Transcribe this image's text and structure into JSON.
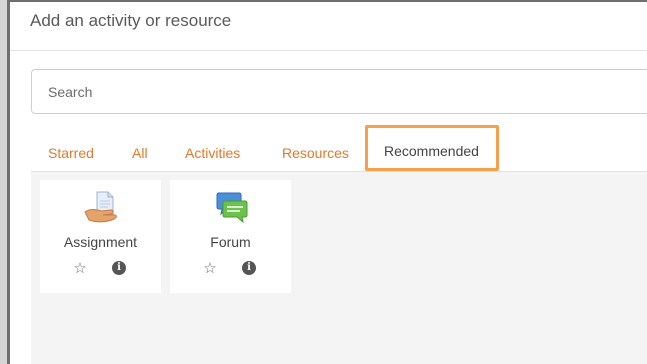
{
  "dialog": {
    "title": "Add an activity or resource"
  },
  "search": {
    "placeholder": "Search",
    "value": ""
  },
  "tabs": [
    {
      "label": "Starred",
      "active": false
    },
    {
      "label": "All",
      "active": false
    },
    {
      "label": "Activities",
      "active": false
    },
    {
      "label": "Resources",
      "active": false
    },
    {
      "label": "Recommended",
      "active": true
    }
  ],
  "modules": [
    {
      "name": "Assignment",
      "icon": "assignment-icon"
    },
    {
      "name": "Forum",
      "icon": "forum-icon"
    }
  ],
  "colors": {
    "tab_link": "#e0792e",
    "active_tab_highlight": "#f6a04d",
    "content_background": "#f4f4f4"
  }
}
